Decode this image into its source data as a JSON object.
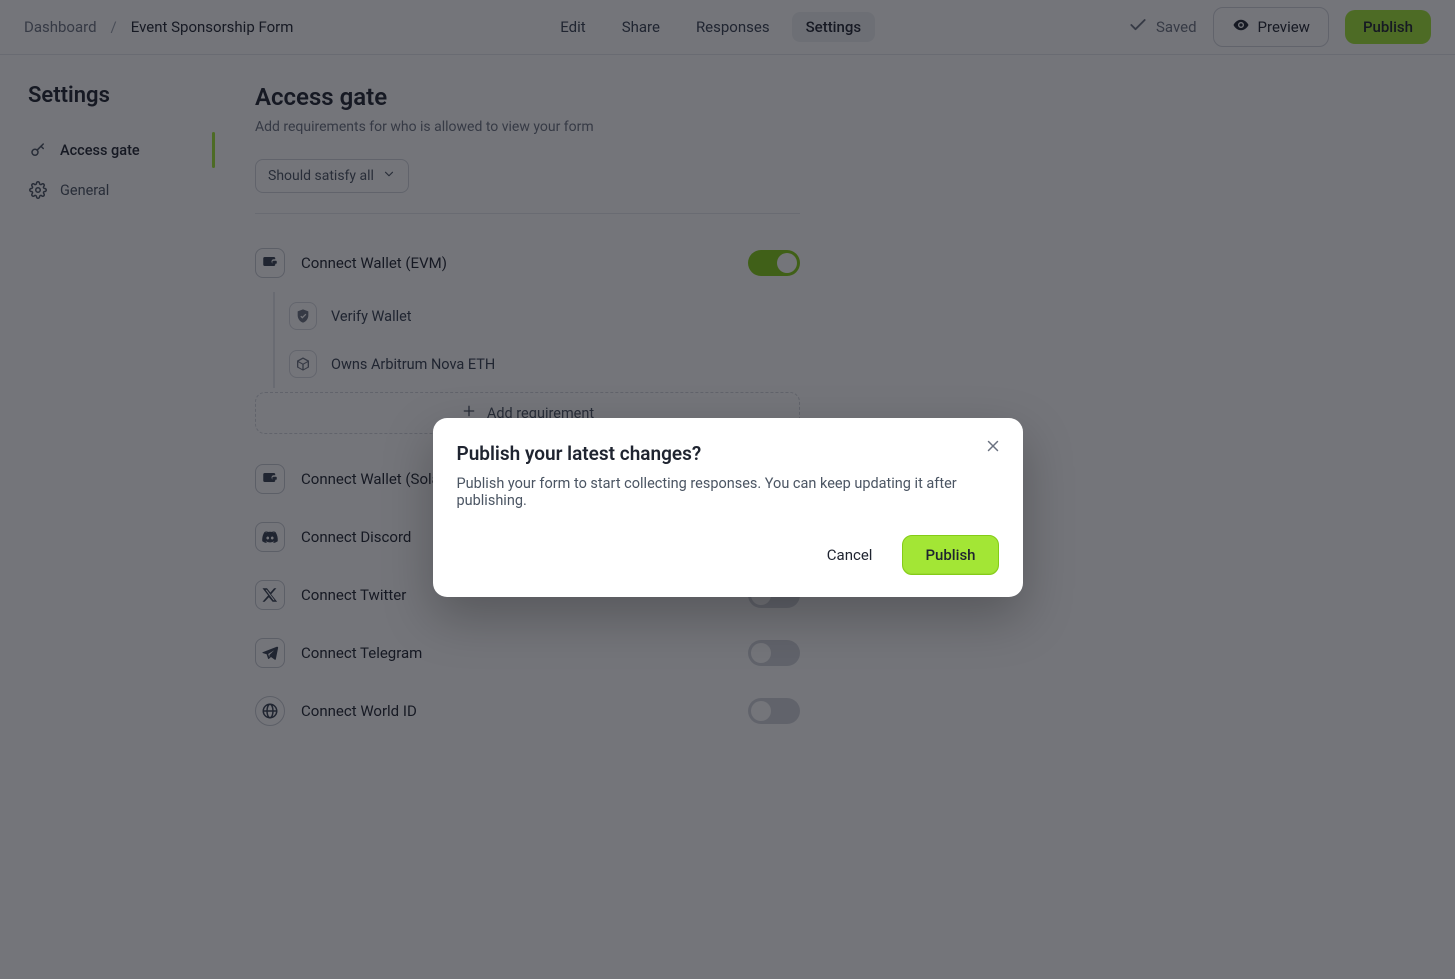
{
  "breadcrumb": {
    "dashboard": "Dashboard",
    "form_name": "Event Sponsorship Form"
  },
  "tabs": {
    "edit": "Edit",
    "share": "Share",
    "responses": "Responses",
    "settings": "Settings"
  },
  "top_actions": {
    "saved": "Saved",
    "preview": "Preview",
    "publish": "Publish"
  },
  "sidebar": {
    "title": "Settings",
    "items": [
      {
        "label": "Access gate",
        "active": true
      },
      {
        "label": "General",
        "active": false
      }
    ]
  },
  "page": {
    "title": "Access gate",
    "subtitle": "Add requirements for who is allowed to view your form",
    "satisfy_label": "Should satisfy all",
    "add_requirement": "Add requirement"
  },
  "gates": [
    {
      "key": "evm",
      "label": "Connect Wallet (EVM)",
      "enabled": true,
      "children": [
        {
          "label": "Verify Wallet"
        },
        {
          "label": "Owns Arbitrum Nova ETH"
        }
      ]
    },
    {
      "key": "solana",
      "label": "Connect Wallet (Solana)",
      "enabled": false
    },
    {
      "key": "discord",
      "label": "Connect Discord",
      "enabled": false
    },
    {
      "key": "twitter",
      "label": "Connect Twitter",
      "enabled": false
    },
    {
      "key": "telegram",
      "label": "Connect Telegram",
      "enabled": false
    },
    {
      "key": "worldid",
      "label": "Connect World ID",
      "enabled": false
    }
  ],
  "modal": {
    "title": "Publish your latest changes?",
    "body": "Publish your form to start collecting responses. You can keep updating it after publishing.",
    "cancel": "Cancel",
    "confirm": "Publish"
  }
}
